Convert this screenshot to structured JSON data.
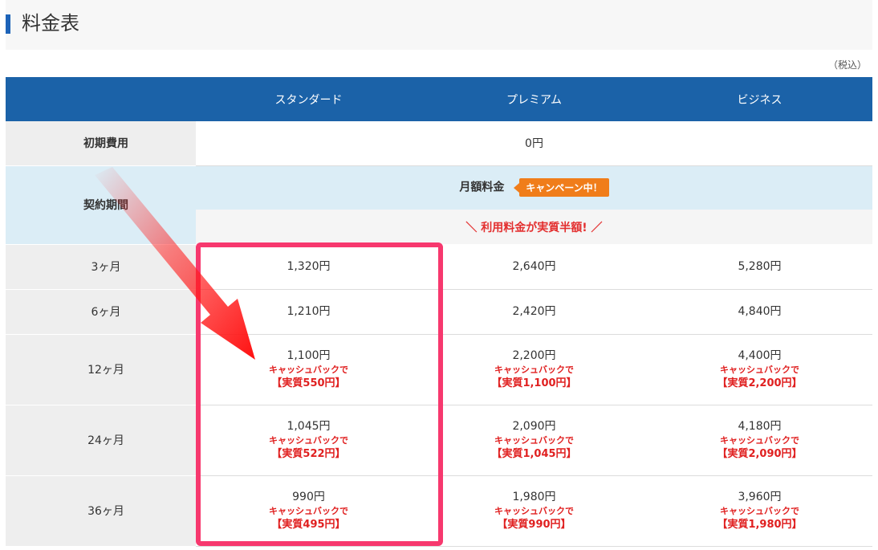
{
  "page": {
    "title": "料金表",
    "tax_note": "（税込）"
  },
  "table": {
    "headers": [
      "",
      "スタンダード",
      "プレミアム",
      "ビジネス"
    ],
    "initial_fee": {
      "label": "初期費用",
      "value": "0円"
    },
    "contract_period_label": "契約期間",
    "monthly_label": "月額料金",
    "campaign_badge": "キャンペーン中！",
    "half_price_line": "＼ 利用料金が実質半額! ／",
    "rows": [
      {
        "label": "3ヶ月",
        "cells": [
          {
            "price": "1,320円"
          },
          {
            "price": "2,640円"
          },
          {
            "price": "5,280円"
          }
        ]
      },
      {
        "label": "6ヶ月",
        "cells": [
          {
            "price": "1,210円"
          },
          {
            "price": "2,420円"
          },
          {
            "price": "4,840円"
          }
        ]
      },
      {
        "label": "12ヶ月",
        "cells": [
          {
            "price": "1,100円",
            "cashback": "キャッシュバックで",
            "effective": "【実質550円】"
          },
          {
            "price": "2,200円",
            "cashback": "キャッシュバックで",
            "effective": "【実質1,100円】"
          },
          {
            "price": "4,400円",
            "cashback": "キャッシュバックで",
            "effective": "【実質2,200円】"
          }
        ]
      },
      {
        "label": "24ヶ月",
        "cells": [
          {
            "price": "1,045円",
            "cashback": "キャッシュバックで",
            "effective": "【実質522円】"
          },
          {
            "price": "2,090円",
            "cashback": "キャッシュバックで",
            "effective": "【実質1,045円】"
          },
          {
            "price": "4,180円",
            "cashback": "キャッシュバックで",
            "effective": "【実質2,090円】"
          }
        ]
      },
      {
        "label": "36ヶ月",
        "cells": [
          {
            "price": "990円",
            "cashback": "キャッシュバックで",
            "effective": "【実質495円】"
          },
          {
            "price": "1,980円",
            "cashback": "キャッシュバックで",
            "effective": "【実質990円】"
          },
          {
            "price": "3,960円",
            "cashback": "キャッシュバックで",
            "effective": "【実質1,980円】"
          }
        ]
      }
    ]
  },
  "colors": {
    "header_blue": "#1b62a8",
    "accent_red": "#e02020",
    "badge_orange": "#f07d1a",
    "highlight_pink": "#f7386e",
    "light_blue": "#dbedf6"
  }
}
